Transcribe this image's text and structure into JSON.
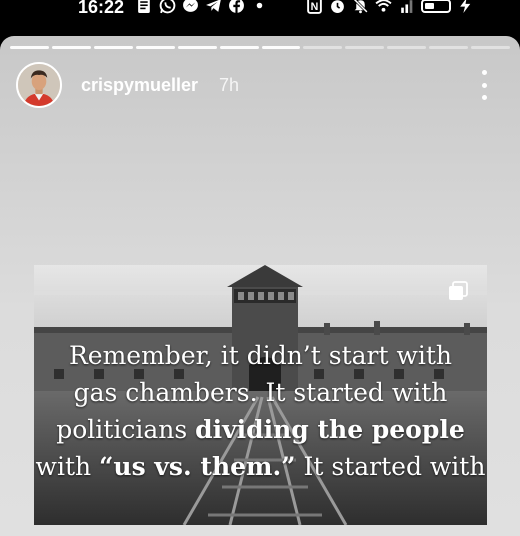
{
  "status_bar": {
    "time": "16:22",
    "left_icons": [
      "notes-icon",
      "whatsapp-icon",
      "messenger-icon",
      "telegram-icon",
      "facebook-icon",
      "dot-icon"
    ],
    "right_icons": [
      "nfc-icon",
      "alarm-icon",
      "mute-icon",
      "wifi-icon",
      "signal-icon",
      "battery-icon",
      "charging-icon"
    ]
  },
  "story": {
    "progress": {
      "total_segments": 12,
      "current_segment": 7
    },
    "username": "crispymueller",
    "time_ago": "7h"
  },
  "post": {
    "line1": "Remember, it didn’t start with",
    "line2": "gas chambers. It started with",
    "line3_pre": "politicians ",
    "line3_bold": "dividing the people",
    "line4_pre": "with ",
    "line4_bold": "“us vs. them.”",
    "line4_post": " It started with"
  }
}
